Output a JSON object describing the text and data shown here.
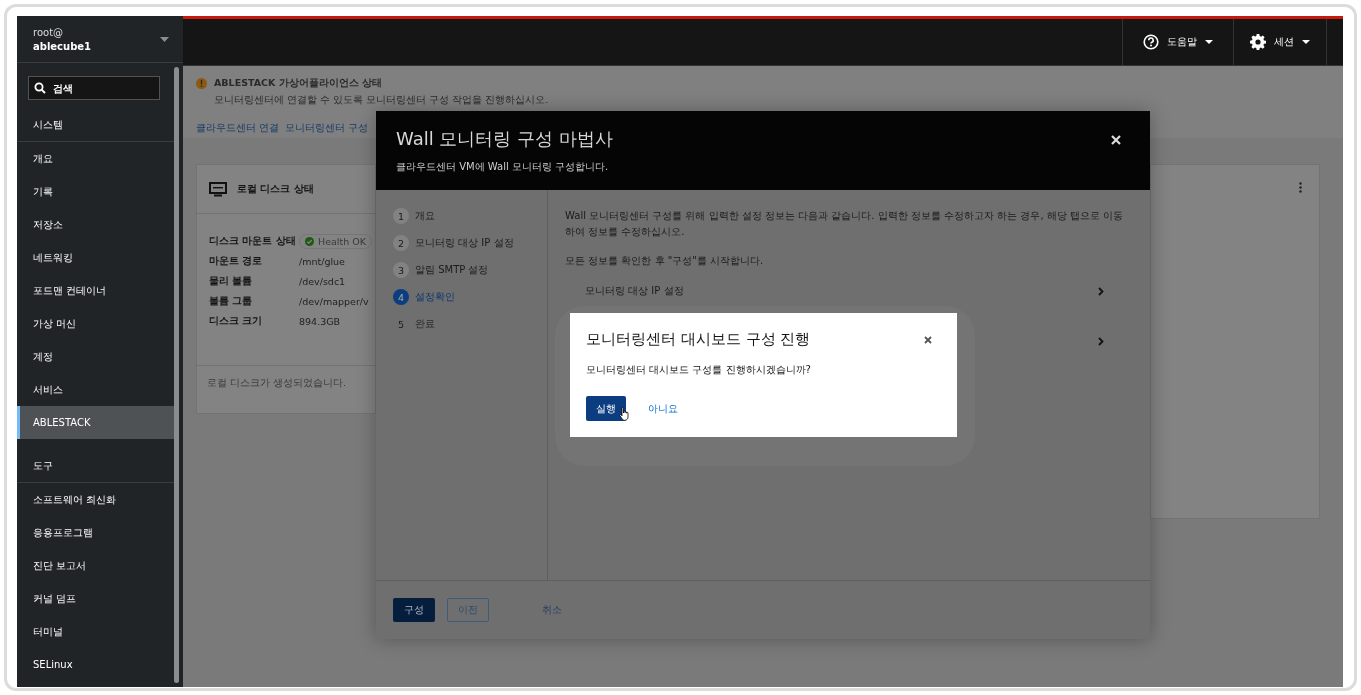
{
  "sidebar": {
    "user": "root@",
    "host": "ablecube1",
    "search": {
      "placeholder": "검색"
    },
    "sections": [
      {
        "heading": "시스템",
        "items": [
          {
            "label": "개요",
            "selected": false
          },
          {
            "label": "기록",
            "selected": false
          },
          {
            "label": "저장소",
            "selected": false
          },
          {
            "label": "네트워킹",
            "selected": false
          },
          {
            "label": "포드맨 컨테이너",
            "selected": false
          },
          {
            "label": "가상 머신",
            "selected": false
          },
          {
            "label": "계정",
            "selected": false
          },
          {
            "label": "서비스",
            "selected": false
          },
          {
            "label": "ABLESTACK",
            "selected": true
          }
        ]
      },
      {
        "heading": "도구",
        "items": [
          {
            "label": "소프트웨어 최신화",
            "selected": false
          },
          {
            "label": "응용프로그램",
            "selected": false
          },
          {
            "label": "진단 보고서",
            "selected": false
          },
          {
            "label": "커널 덤프",
            "selected": false
          },
          {
            "label": "터미널",
            "selected": false
          },
          {
            "label": "SELinux",
            "selected": false
          }
        ]
      }
    ]
  },
  "topbar": {
    "buttons": [
      {
        "kind": "help",
        "label": "도움말"
      },
      {
        "kind": "settings",
        "label": "세션"
      }
    ]
  },
  "alert": {
    "title": "ABLESTACK 가상어플라이언스 상태",
    "message": "모니터링센터에 연결할 수 있도록 모니터링센터 구성 작업을 진행하십시오.",
    "links": [
      "클라우드센터 연결",
      "모니터링센터 구성"
    ]
  },
  "disk_card": {
    "title": "로컬 디스크 상태",
    "rows": [
      {
        "label": "디스크 마운트 상태",
        "value": "Health OK",
        "kind": "status"
      },
      {
        "label": "마운트 경로",
        "value": "/mnt/glue",
        "kind": "text"
      },
      {
        "label": "물리 볼륨",
        "value": "/dev/sdc1",
        "kind": "text"
      },
      {
        "label": "볼륨 그룹",
        "value": "/dev/mapper/v",
        "kind": "text"
      },
      {
        "label": "디스크 크기",
        "value": "894.3GB",
        "kind": "text"
      }
    ],
    "footer": "로컬 디스크가 생성되었습니다."
  },
  "wizard": {
    "title": "Wall 모니터링 구성 마법사",
    "subtitle": "클라우드센터 VM에 Wall 모니터링 구성합니다.",
    "steps": [
      {
        "number": "1",
        "label": "개요",
        "selected": false,
        "visited": true
      },
      {
        "number": "2",
        "label": "모니터링 대상 IP 설정",
        "selected": false,
        "visited": true
      },
      {
        "number": "3",
        "label": "알림 SMTP 설정",
        "selected": false,
        "visited": true
      },
      {
        "number": "4",
        "label": "설정확인",
        "selected": true,
        "visited": true
      },
      {
        "number": "5",
        "label": "완료",
        "selected": false,
        "visited": false
      }
    ],
    "description": "Wall 모니터링센터 구성를 위해 입력한 설정 정보는 다음과 같습니다. 입력한 정보를 수정하고자 하는 경우, 해당 탭으로 이동하여 정보를 수정하십시오.",
    "note": "모든 정보를 확인한 후 \"구성\"를 시작합니다.",
    "sections": [
      {
        "kind": "titled",
        "title": "모니터링 대상 IP 설정"
      },
      {
        "kind": "covered"
      }
    ],
    "buttons": [
      {
        "kind": "primary",
        "label": "구성"
      },
      {
        "kind": "secondary",
        "label": "이전"
      },
      {
        "kind": "link",
        "label": "취소"
      }
    ]
  },
  "dialog": {
    "title": "모니터링센터 대시보드 구성 진행",
    "message": "모니터링센터 대시보드 구성를 진행하시겠습니까?",
    "buttons": [
      {
        "kind": "primary",
        "label": "실행"
      },
      {
        "kind": "link",
        "label": "아니요"
      }
    ]
  }
}
